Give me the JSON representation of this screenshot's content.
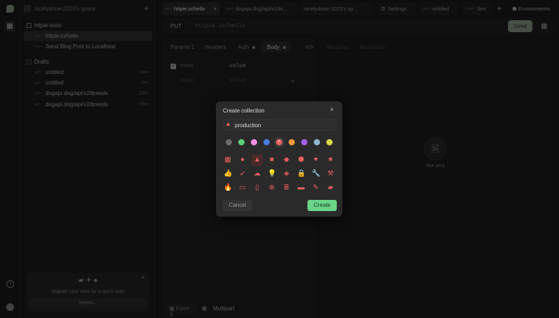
{
  "workspace": "nicelydone-2023's space",
  "sidebar": {
    "collection": "httpie tests",
    "items": [
      {
        "method": "PUT",
        "label": "httpie.io/hello"
      },
      {
        "method": "POST",
        "label": "Send Blog Post to Localhost"
      }
    ],
    "drafts_label": "Drafts",
    "drafts": [
      {
        "method": "GET",
        "label": "untitled",
        "time": "now"
      },
      {
        "method": "GET",
        "label": "untitled",
        "time": "1m"
      },
      {
        "method": "GET",
        "label": "dogapi.dog/api/v2/breeds",
        "time": "15m"
      },
      {
        "method": "GET",
        "label": "dogapi.dog/api/v2/breeds",
        "time": "15m"
      }
    ],
    "migrate_text": "Migrate your data for a quick start",
    "import_label": "Import..."
  },
  "tabs": [
    {
      "method": "PUT",
      "label": "httpie.io/hello"
    },
    {
      "method": "GET",
      "label": "dogapi.dog/api/v2/br..."
    },
    {
      "method": "",
      "label": "nicelydone-2023's sp..."
    },
    {
      "method": "",
      "label": "Settings"
    },
    {
      "method": "GET",
      "label": "untitled"
    },
    {
      "method": "POST",
      "label": "Sen"
    }
  ],
  "environments_label": "Environments",
  "request": {
    "method": "PUT",
    "url": "httpie.io/hello",
    "send_label": "Send",
    "tabs": [
      "Params 1",
      "Headers",
      "Auth",
      "Body"
    ],
    "fields": [
      {
        "name": "name",
        "value": "value"
      },
      {
        "name": "name",
        "value": "value"
      }
    ],
    "body_type": "Form",
    "multipart_label": "Multipart"
  },
  "response": {
    "tabs": [
      "Request",
      "Response"
    ],
    "status": "Not sent"
  },
  "modal": {
    "title": "Create collection",
    "name_value": "production",
    "cancel_label": "Cancel",
    "create_label": "Create",
    "colors": [
      "#6b6b6b",
      "#5fcf7a",
      "#f08fe0",
      "#4a7be0",
      "#e8625a",
      "#f0973f",
      "#a35ce6",
      "#8fb7cf",
      "#d8d84a"
    ],
    "selected_color": "#e8625a",
    "icons": [
      "grid",
      "circle",
      "triangle",
      "square",
      "diamond",
      "hexagon",
      "heart",
      "star",
      "thumbs-up",
      "rocket",
      "cloud",
      "lightbulb",
      "gem",
      "lock",
      "wrench",
      "hammer",
      "flame",
      "monitor",
      "phone",
      "globe",
      "database",
      "credit-card",
      "edit",
      "chat"
    ],
    "selected_icon": "triangle"
  }
}
